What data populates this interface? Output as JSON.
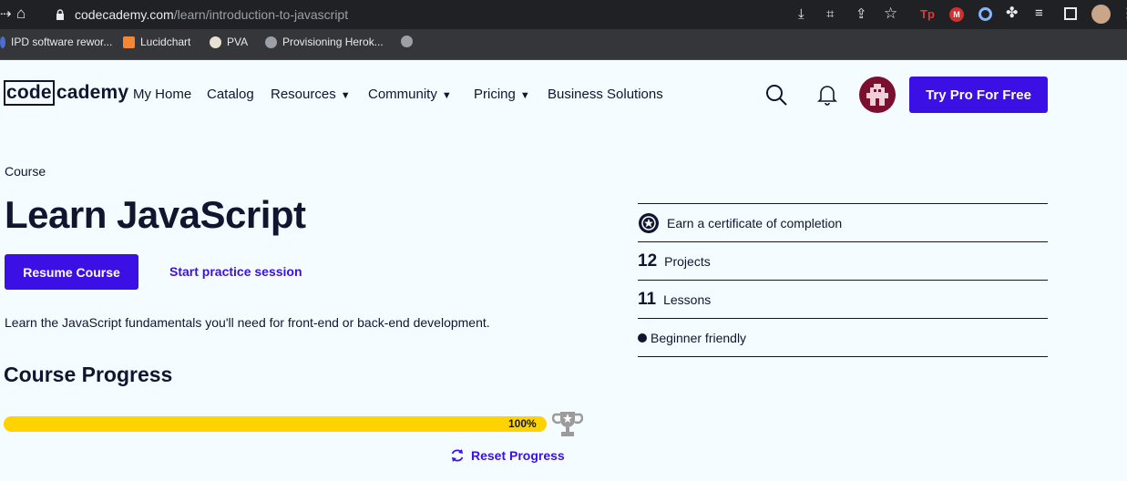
{
  "browser": {
    "url_domain": "codecademy.com",
    "url_path": "/learn/introduction-to-javascript",
    "bookmarks": [
      "IPD software rewor...",
      "Lucidchart",
      "PVA",
      "Provisioning Herok..."
    ],
    "extension_labels": [
      "Tp",
      "M"
    ]
  },
  "nav": {
    "logo_code": "code",
    "logo_academy": "cademy",
    "items": [
      "My Home",
      "Catalog",
      "Resources",
      "Community",
      "Pricing",
      "Business Solutions"
    ],
    "caret": "▼",
    "cta": "Try Pro For Free"
  },
  "course": {
    "label": "Course",
    "title": "Learn JavaScript",
    "resume": "Resume Course",
    "practice": "Start practice session",
    "description": "Learn the JavaScript fundamentals you'll need for front-end or back-end development."
  },
  "progress": {
    "heading": "Course Progress",
    "percent_label": "100%",
    "fraction": 1.0,
    "reset": "Reset Progress"
  },
  "sidebar": {
    "certificate": "Earn a certificate of completion",
    "projects_count": "12",
    "projects_label": "Projects",
    "lessons_count": "11",
    "lessons_label": "Lessons",
    "level": "Beginner friendly"
  },
  "colors": {
    "accent": "#3a10e5",
    "progress": "#ffd300",
    "page_bg": "#f5fcff",
    "text": "#10162f"
  }
}
